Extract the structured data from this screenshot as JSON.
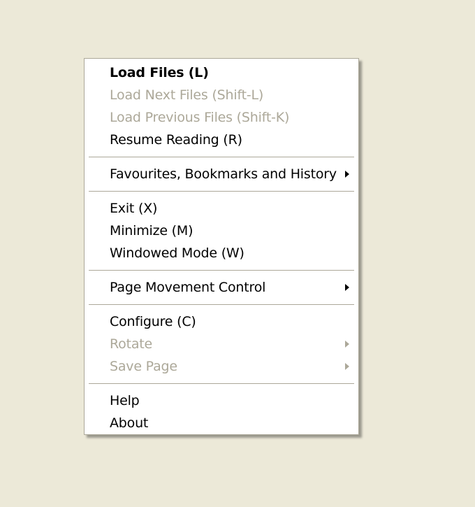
{
  "menu": {
    "load_files": "Load Files (L)",
    "load_next_files": "Load Next Files (Shift-L)",
    "load_previous_files": "Load Previous Files (Shift-K)",
    "resume_reading": "Resume Reading (R)",
    "favourites": "Favourites, Bookmarks and History",
    "exit": "Exit (X)",
    "minimize": "Minimize (M)",
    "windowed_mode": "Windowed Mode (W)",
    "page_movement_control": "Page Movement Control",
    "configure": "Configure (C)",
    "rotate": "Rotate",
    "save_page": "Save Page",
    "help": "Help",
    "about": "About"
  },
  "colors": {
    "background": "#ECE9D8",
    "menu_background": "#FFFFFF",
    "menu_border": "#ACA899",
    "disabled_text": "#ACA899",
    "text": "#000000"
  }
}
